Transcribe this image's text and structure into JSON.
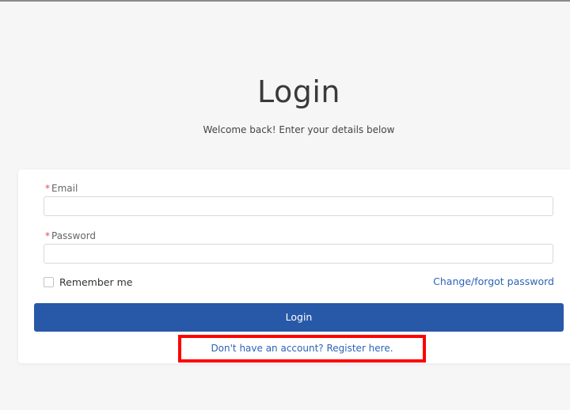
{
  "page": {
    "title": "Login",
    "subtitle": "Welcome back! Enter your details below"
  },
  "form": {
    "email": {
      "label": "Email",
      "required_mark": "*",
      "value": "",
      "placeholder": ""
    },
    "password": {
      "label": "Password",
      "required_mark": "*",
      "value": "",
      "placeholder": ""
    },
    "remember_me": {
      "label": "Remember me",
      "checked": false
    },
    "forgot_link": "Change/forgot password",
    "submit_label": "Login",
    "register_link": "Don't have an account? Register here."
  },
  "colors": {
    "primary": "#2859a8",
    "link": "#2d63b8",
    "required": "#d9534f",
    "highlight": "#ff0000",
    "background": "#f6f6f7"
  }
}
